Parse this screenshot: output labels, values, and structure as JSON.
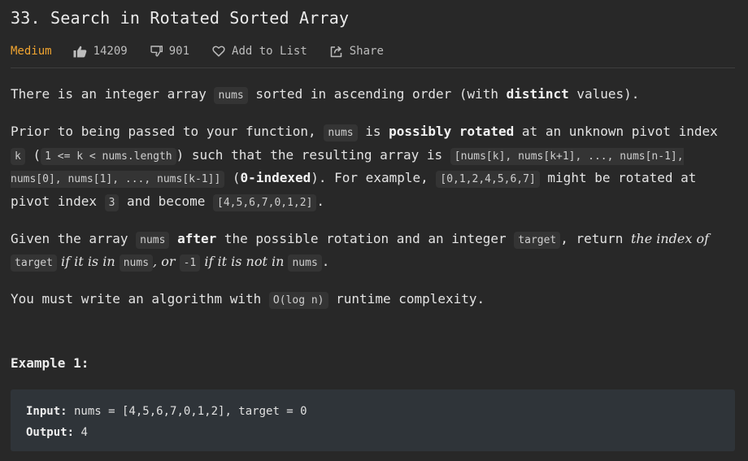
{
  "problem": {
    "title": "33. Search in Rotated Sorted Array",
    "difficulty": "Medium",
    "likes": "14209",
    "dislikes": "901",
    "add_to_list": "Add to List",
    "share": "Share"
  },
  "description": {
    "p1": {
      "t1": "There is an integer array ",
      "c1": "nums",
      "t2": " sorted in ascending order (with ",
      "b1": "distinct",
      "t3": " values)."
    },
    "p2": {
      "t1": "Prior to being passed to your function, ",
      "c1": "nums",
      "t2": " is ",
      "b1": "possibly rotated",
      "t3": " at an unknown pivot index ",
      "c2": "k",
      "t4": " (",
      "c3": "1 <= k < nums.length",
      "t5": ") such that the resulting array is ",
      "c4": "[nums[k], nums[k+1], ..., nums[n-1], nums[0], nums[1], ..., nums[k-1]]",
      "t6": " (",
      "b2": "0-indexed",
      "t7": "). For example, ",
      "c5": "[0,1,2,4,5,6,7]",
      "t8": " might be rotated at pivot index ",
      "c6": "3",
      "t9": " and become ",
      "c7": "[4,5,6,7,0,1,2]",
      "t10": "."
    },
    "p3": {
      "t1": "Given the array ",
      "c1": "nums",
      "t2": " ",
      "b1": "after",
      "t3": " the possible rotation and an integer ",
      "c2": "target",
      "t4": ", return ",
      "i1": "the index of ",
      "c3": "target",
      "i2": " if it is in ",
      "c4": "nums",
      "i3": ", or ",
      "c5": "-1",
      "i4": " if it is not in ",
      "c6": "nums",
      "t5": "."
    },
    "p4": {
      "t1": "You must write an algorithm with ",
      "c1": "O(log n)",
      "t2": " runtime complexity."
    }
  },
  "example1": {
    "title": "Example 1:",
    "input_label": "Input:",
    "input_value": " nums = [4,5,6,7,0,1,2], target = 0",
    "output_label": "Output:",
    "output_value": " 4"
  },
  "colors": {
    "background": "#282828",
    "difficulty_medium": "#f0a430",
    "example_bg": "#2f3439"
  },
  "icons": [
    "thumbs-up-icon",
    "thumbs-down-icon",
    "heart-icon",
    "share-icon"
  ]
}
